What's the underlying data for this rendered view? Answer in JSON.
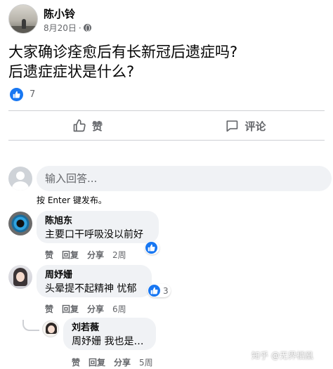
{
  "post": {
    "author": "陈小铃",
    "date": "8月20日",
    "separator": "·",
    "text_line1": "大家确诊痊愈后有长新冠后遗症吗?",
    "text_line2": "后遗症症状是什么?",
    "like_count": "7"
  },
  "actions": {
    "like_label": "赞",
    "comment_label": "评论"
  },
  "composer": {
    "placeholder": "输入回答...",
    "hint": "按 Enter 键发布。"
  },
  "comments": [
    {
      "author": "陈旭东",
      "text": "主要口干呼吸没以前好",
      "reaction_count": "",
      "like": "赞",
      "reply": "回复",
      "share": "分享",
      "time": "2周"
    },
    {
      "author": "周妤姗",
      "text": "头晕提不起精神 忧郁",
      "reaction_count": "3",
      "like": "赞",
      "reply": "回复",
      "share": "分享",
      "time": "6周"
    },
    {
      "author": "刘若薇",
      "text": "周妤姗 我也是…",
      "reaction_count": "",
      "like": "赞",
      "reply": "回复",
      "share": "分享",
      "time": "5周"
    }
  ],
  "watermark": "知乎 @无界栖凰",
  "colors": {
    "accent": "#1877f2",
    "muted": "#65676b",
    "bubble": "#f0f2f5",
    "divider": "#ced0d4"
  },
  "icons": [
    "globe-icon",
    "like-icon",
    "thumbs-up-outline-icon",
    "comment-icon",
    "user-avatar-placeholder"
  ]
}
